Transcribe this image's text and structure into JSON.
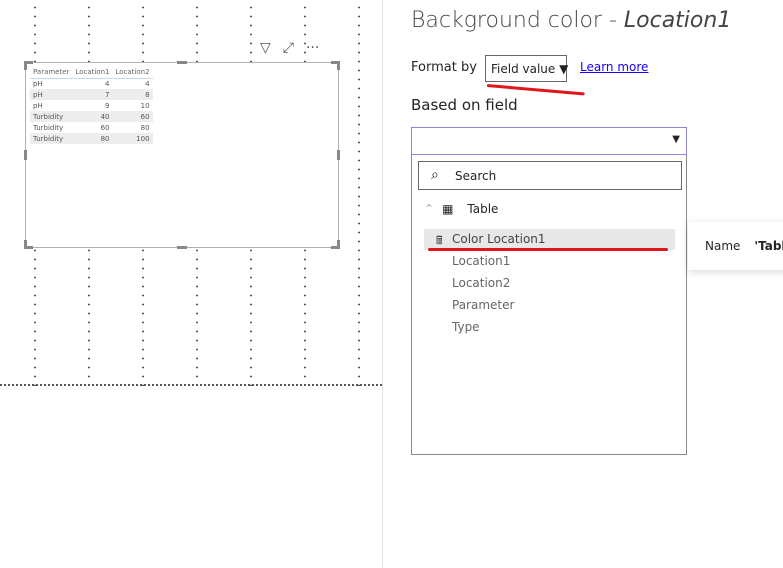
{
  "visual": {
    "toolbar": {
      "filter_icon": "filter-icon",
      "focus_icon": "focus-mode-icon",
      "more_icon": "more-options-icon"
    },
    "table": {
      "headers": [
        "Parameter",
        "Location1",
        "Location2"
      ],
      "rows": [
        [
          "pH",
          "4",
          "4"
        ],
        [
          "pH",
          "7",
          "8"
        ],
        [
          "pH",
          "9",
          "10"
        ],
        [
          "Turbidity",
          "40",
          "60"
        ],
        [
          "Turbidity",
          "60",
          "80"
        ],
        [
          "Turbidity",
          "80",
          "100"
        ]
      ]
    }
  },
  "panel": {
    "title": "Background color - ",
    "title_field": "Location1",
    "format_by_label": "Format by",
    "format_by_value": "Field value",
    "learn_more": "Learn more",
    "based_on_label": "Based on field",
    "based_on_value": "",
    "search_placeholder": "Search",
    "table_name": "Table",
    "fields": [
      "Color Location1",
      "Location1",
      "Location2",
      "Parameter",
      "Type"
    ]
  },
  "tooltip": {
    "label": "Name",
    "value": "'Table'"
  },
  "colors": {
    "annotation": "#e0161b",
    "link": "#1b00ff"
  }
}
